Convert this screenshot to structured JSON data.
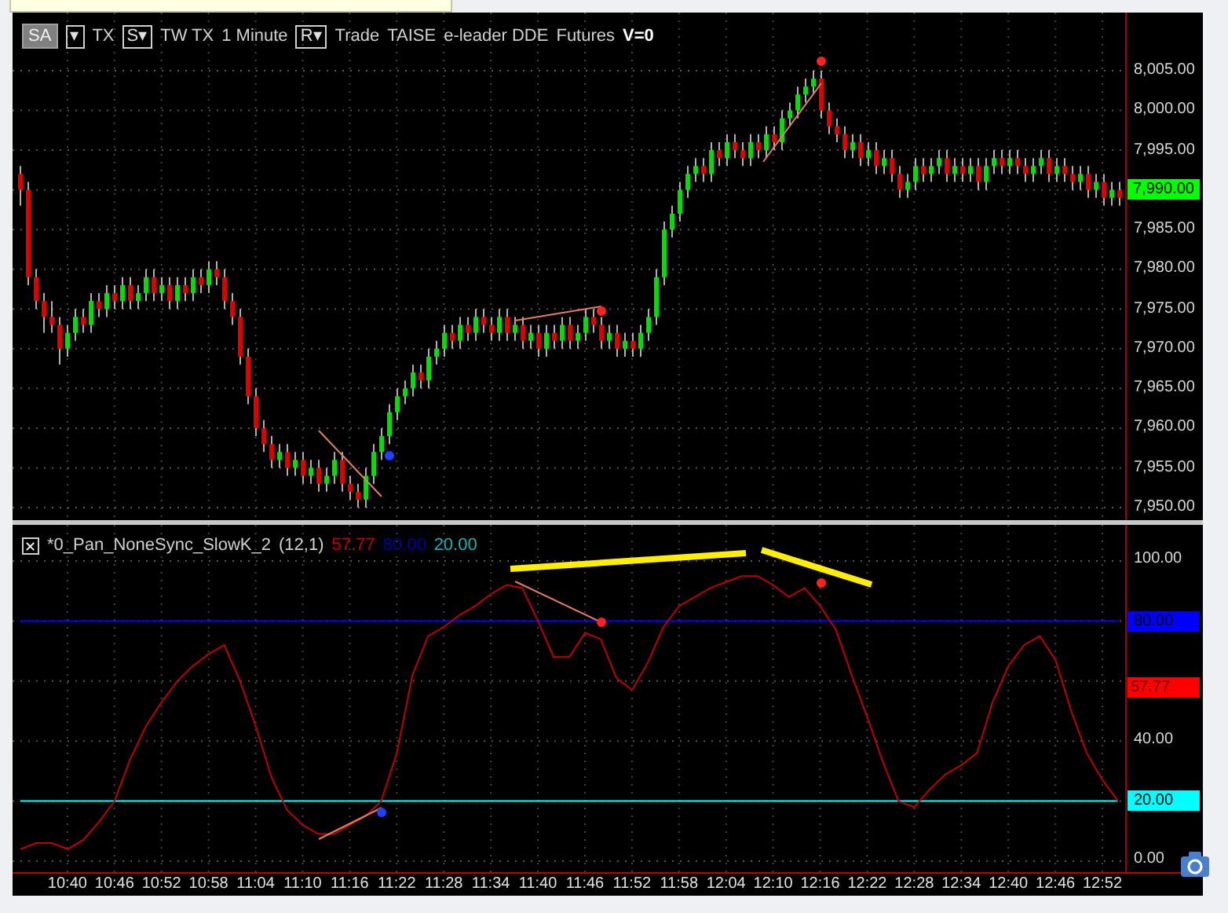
{
  "toolbar": [
    {
      "kind": "box",
      "text": "SA"
    },
    {
      "kind": "dropdown",
      "text": "▾"
    },
    {
      "kind": "label",
      "text": "TX"
    },
    {
      "kind": "dropdown",
      "text": "S▾"
    },
    {
      "kind": "label",
      "text": "TW TX"
    },
    {
      "kind": "label",
      "text": "1 Minute"
    },
    {
      "kind": "dropdown",
      "text": "R▾"
    },
    {
      "kind": "label",
      "text": "Trade"
    },
    {
      "kind": "label",
      "text": "TAISE"
    },
    {
      "kind": "label",
      "text": "e-leader DDE"
    },
    {
      "kind": "label",
      "text": "Futures"
    },
    {
      "kind": "strong",
      "text": "V=0"
    }
  ],
  "price_pane": {
    "last_price": "7,990.00",
    "chart_data": {
      "type": "candlestick",
      "grid": true,
      "ylim": [
        7948,
        8012
      ],
      "yticks": [
        {
          "value": 8005,
          "label": "8,005.00"
        },
        {
          "value": 8000,
          "label": "8,000.00"
        },
        {
          "value": 7995,
          "label": "7,995.00"
        },
        {
          "value": 7985,
          "label": "7,985.00"
        },
        {
          "value": 7980,
          "label": "7,980.00"
        },
        {
          "value": 7975,
          "label": "7,975.00"
        },
        {
          "value": 7970,
          "label": "7,970.00"
        },
        {
          "value": 7965,
          "label": "7,965.00"
        },
        {
          "value": 7960,
          "label": "7,960.00"
        },
        {
          "value": 7955,
          "label": "7,955.00"
        },
        {
          "value": 7950,
          "label": "7,950.00"
        }
      ],
      "categories": [
        null,
        null,
        null,
        null,
        null,
        null,
        null,
        null,
        null,
        null,
        null,
        null,
        null,
        null,
        null,
        null,
        null,
        null,
        null,
        null,
        null,
        null,
        null,
        null,
        null,
        null,
        null,
        null,
        null,
        null,
        null,
        null,
        null,
        null,
        null,
        null,
        null,
        null,
        null,
        null,
        null,
        null,
        null,
        null,
        null,
        null,
        null,
        null,
        null,
        null,
        null,
        null,
        null,
        null,
        null,
        null,
        null,
        null,
        null,
        null,
        null,
        null,
        null,
        null,
        null,
        null,
        null,
        null,
        null,
        null,
        null,
        null,
        null,
        null,
        null,
        null,
        null,
        null,
        null,
        null,
        null,
        null,
        null,
        null,
        null,
        null,
        null,
        null,
        null,
        null,
        null,
        null,
        null,
        null,
        null,
        null,
        null,
        null,
        null,
        null,
        null,
        null,
        null,
        null,
        null,
        null,
        null,
        null,
        null,
        null,
        null,
        null,
        null,
        null,
        null,
        null,
        null,
        null,
        null,
        null,
        null,
        null,
        null,
        null,
        null,
        null,
        null,
        null,
        null,
        null,
        null,
        null,
        null,
        null,
        null,
        null,
        null,
        null,
        null,
        null,
        null
      ],
      "ohlc": [
        [
          7992,
          7993,
          7988,
          7990
        ],
        [
          7990,
          7991,
          7978,
          7979
        ],
        [
          7979,
          7980,
          7975,
          7976
        ],
        [
          7976,
          7977,
          7972,
          7974
        ],
        [
          7974,
          7976,
          7972,
          7973
        ],
        [
          7973,
          7974,
          7968,
          7970
        ],
        [
          7970,
          7973,
          7969,
          7972
        ],
        [
          7972,
          7975,
          7971,
          7974
        ],
        [
          7974,
          7975,
          7972,
          7973
        ],
        [
          7973,
          7977,
          7972,
          7976
        ],
        [
          7976,
          7977,
          7974,
          7975
        ],
        [
          7975,
          7978,
          7974,
          7977
        ],
        [
          7977,
          7978,
          7975,
          7976
        ],
        [
          7976,
          7979,
          7975,
          7978
        ],
        [
          7978,
          7979,
          7975,
          7976
        ],
        [
          7976,
          7978,
          7975,
          7977
        ],
        [
          7977,
          7980,
          7976,
          7979
        ],
        [
          7979,
          7980,
          7976,
          7977
        ],
        [
          7977,
          7979,
          7976,
          7978
        ],
        [
          7978,
          7979,
          7975,
          7976
        ],
        [
          7976,
          7979,
          7975,
          7978
        ],
        [
          7978,
          7979,
          7976,
          7977
        ],
        [
          7977,
          7980,
          7976,
          7979
        ],
        [
          7979,
          7980,
          7977,
          7978
        ],
        [
          7978,
          7981,
          7977,
          7980
        ],
        [
          7980,
          7981,
          7978,
          7979
        ],
        [
          7979,
          7980,
          7975,
          7976
        ],
        [
          7976,
          7977,
          7973,
          7974
        ],
        [
          7974,
          7975,
          7968,
          7969
        ],
        [
          7969,
          7970,
          7963,
          7964
        ],
        [
          7964,
          7965,
          7959,
          7960
        ],
        [
          7960,
          7961,
          7957,
          7958
        ],
        [
          7958,
          7959,
          7955,
          7956
        ],
        [
          7956,
          7958,
          7955,
          7957
        ],
        [
          7957,
          7958,
          7954,
          7955
        ],
        [
          7955,
          7957,
          7954,
          7956
        ],
        [
          7956,
          7957,
          7953,
          7954
        ],
        [
          7954,
          7956,
          7953,
          7955
        ],
        [
          7955,
          7956,
          7952,
          7953
        ],
        [
          7953,
          7955,
          7952,
          7954
        ],
        [
          7954,
          7957,
          7953,
          7956
        ],
        [
          7956,
          7957,
          7952,
          7953
        ],
        [
          7953,
          7954,
          7951,
          7952
        ],
        [
          7952,
          7953,
          7950,
          7951
        ],
        [
          7951,
          7955,
          7950,
          7954
        ],
        [
          7954,
          7958,
          7953,
          7957
        ],
        [
          7957,
          7960,
          7956,
          7959
        ],
        [
          7959,
          7963,
          7958,
          7962
        ],
        [
          7962,
          7965,
          7961,
          7964
        ],
        [
          7964,
          7966,
          7963,
          7965
        ],
        [
          7965,
          7968,
          7964,
          7967
        ],
        [
          7967,
          7968,
          7965,
          7966
        ],
        [
          7966,
          7970,
          7965,
          7969
        ],
        [
          7969,
          7971,
          7968,
          7970
        ],
        [
          7970,
          7973,
          7969,
          7972
        ],
        [
          7972,
          7973,
          7970,
          7971
        ],
        [
          7971,
          7974,
          7970,
          7973
        ],
        [
          7973,
          7974,
          7971,
          7972
        ],
        [
          7972,
          7975,
          7971,
          7974
        ],
        [
          7974,
          7975,
          7972,
          7973
        ],
        [
          7973,
          7974,
          7971,
          7972
        ],
        [
          7972,
          7975,
          7971,
          7974
        ],
        [
          7974,
          7975,
          7971,
          7972
        ],
        [
          7972,
          7974,
          7971,
          7973
        ],
        [
          7973,
          7974,
          7970,
          7971
        ],
        [
          7971,
          7973,
          7970,
          7972
        ],
        [
          7972,
          7973,
          7969,
          7970
        ],
        [
          7970,
          7973,
          7969,
          7972
        ],
        [
          7972,
          7973,
          7970,
          7971
        ],
        [
          7971,
          7974,
          7970,
          7973
        ],
        [
          7973,
          7974,
          7970,
          7971
        ],
        [
          7971,
          7973,
          7970,
          7972
        ],
        [
          7972,
          7975,
          7971,
          7974
        ],
        [
          7974,
          7975,
          7972,
          7973
        ],
        [
          7973,
          7974,
          7970,
          7971
        ],
        [
          7971,
          7973,
          7970,
          7972
        ],
        [
          7972,
          7973,
          7969,
          7970
        ],
        [
          7970,
          7972,
          7969,
          7971
        ],
        [
          7971,
          7972,
          7969,
          7970
        ],
        [
          7970,
          7973,
          7969,
          7972
        ],
        [
          7972,
          7975,
          7971,
          7974
        ],
        [
          7974,
          7980,
          7973,
          7979
        ],
        [
          7979,
          7986,
          7978,
          7985
        ],
        [
          7985,
          7988,
          7984,
          7987
        ],
        [
          7987,
          7991,
          7986,
          7990
        ],
        [
          7990,
          7993,
          7989,
          7992
        ],
        [
          7992,
          7994,
          7991,
          7993
        ],
        [
          7993,
          7994,
          7991,
          7992
        ],
        [
          7992,
          7996,
          7991,
          7995
        ],
        [
          7995,
          7996,
          7993,
          7994
        ],
        [
          7994,
          7997,
          7993,
          7996
        ],
        [
          7996,
          7997,
          7994,
          7995
        ],
        [
          7995,
          7996,
          7993,
          7994
        ],
        [
          7994,
          7997,
          7993,
          7996
        ],
        [
          7996,
          7997,
          7994,
          7995
        ],
        [
          7995,
          7998,
          7994,
          7997
        ],
        [
          7997,
          7998,
          7995,
          7996
        ],
        [
          7996,
          8000,
          7995,
          7999
        ],
        [
          7999,
          8001,
          7998,
          8000
        ],
        [
          8000,
          8003,
          7999,
          8002
        ],
        [
          8002,
          8004,
          8001,
          8003
        ],
        [
          8003,
          8005,
          8002,
          8004
        ],
        [
          8004,
          8005,
          7999,
          8000
        ],
        [
          8000,
          8001,
          7997,
          7998
        ],
        [
          7998,
          7999,
          7996,
          7997
        ],
        [
          7997,
          7998,
          7994,
          7995
        ],
        [
          7995,
          7997,
          7994,
          7996
        ],
        [
          7996,
          7997,
          7993,
          7994
        ],
        [
          7994,
          7996,
          7993,
          7995
        ],
        [
          7995,
          7996,
          7992,
          7993
        ],
        [
          7993,
          7995,
          7992,
          7994
        ],
        [
          7994,
          7995,
          7991,
          7992
        ],
        [
          7992,
          7993,
          7989,
          7990
        ],
        [
          7990,
          7992,
          7989,
          7991
        ],
        [
          7991,
          7994,
          7990,
          7993
        ],
        [
          7993,
          7994,
          7991,
          7992
        ],
        [
          7992,
          7994,
          7991,
          7993
        ],
        [
          7993,
          7995,
          7992,
          7994
        ],
        [
          7994,
          7995,
          7991,
          7992
        ],
        [
          7992,
          7994,
          7991,
          7993
        ],
        [
          7993,
          7994,
          7991,
          7992
        ],
        [
          7992,
          7994,
          7991,
          7993
        ],
        [
          7993,
          7994,
          7990,
          7991
        ],
        [
          7991,
          7994,
          7990,
          7993
        ],
        [
          7993,
          7995,
          7992,
          7994
        ],
        [
          7994,
          7995,
          7992,
          7993
        ],
        [
          7993,
          7995,
          7992,
          7994
        ],
        [
          7994,
          7995,
          7992,
          7993
        ],
        [
          7993,
          7994,
          7991,
          7992
        ],
        [
          7992,
          7994,
          7991,
          7993
        ],
        [
          7993,
          7995,
          7992,
          7994
        ],
        [
          7994,
          7995,
          7991,
          7992
        ],
        [
          7992,
          7994,
          7991,
          7993
        ],
        [
          7993,
          7994,
          7991,
          7992
        ],
        [
          7992,
          7993,
          7990,
          7991
        ],
        [
          7991,
          7993,
          7990,
          7992
        ],
        [
          7992,
          7993,
          7989,
          7990
        ],
        [
          7990,
          7992,
          7989,
          7991
        ],
        [
          7991,
          7992,
          7988,
          7989
        ],
        [
          7989,
          7991,
          7988,
          7990
        ],
        [
          7990,
          7991,
          7988,
          7989
        ]
      ]
    }
  },
  "indicator": {
    "close_icon": "✕",
    "name": "*0_Pan_NoneSync_SlowK_2",
    "params": "(12,1)",
    "values": [
      {
        "text": "57.77",
        "color": "#c00000"
      },
      {
        "text": "80.00",
        "color": "#0000a0"
      },
      {
        "text": "20.00",
        "color": "#20b0b0"
      }
    ],
    "last_value_badge": {
      "text": "57.77",
      "color": "#ff0000"
    },
    "chart_data": {
      "type": "line",
      "grid": true,
      "categories": [
        null,
        null,
        null,
        null,
        null,
        null,
        null,
        null,
        null,
        null,
        null,
        null,
        null,
        null,
        null,
        null,
        null,
        null,
        null,
        null,
        null,
        null,
        null,
        null,
        null,
        null,
        null,
        null,
        null,
        null,
        null,
        null,
        null,
        null,
        null,
        null,
        null,
        null,
        null,
        null,
        null,
        null,
        null,
        null,
        null,
        null,
        null,
        null,
        null,
        null,
        null,
        null,
        null,
        null,
        null,
        null,
        null,
        null,
        null,
        null,
        null,
        null,
        null,
        null,
        null,
        null,
        null,
        null,
        null,
        null,
        null
      ],
      "series": [
        {
          "color": "#0000ff",
          "values": [
            80,
            80,
            80,
            80,
            80,
            80,
            80,
            80,
            80,
            80,
            80,
            80,
            80,
            80,
            80,
            80,
            80,
            80,
            80,
            80,
            80,
            80,
            80,
            80,
            80,
            80,
            80,
            80,
            80,
            80,
            80,
            80,
            80,
            80,
            80,
            80,
            80,
            80,
            80,
            80,
            80,
            80,
            80,
            80,
            80,
            80,
            80,
            80,
            80,
            80,
            80,
            80,
            80,
            80,
            80,
            80,
            80,
            80,
            80,
            80,
            80,
            80,
            80,
            80,
            80,
            80,
            80,
            80,
            80,
            80,
            80
          ]
        },
        {
          "color": "#00ffff",
          "values": [
            20,
            20,
            20,
            20,
            20,
            20,
            20,
            20,
            20,
            20,
            20,
            20,
            20,
            20,
            20,
            20,
            20,
            20,
            20,
            20,
            20,
            20,
            20,
            20,
            20,
            20,
            20,
            20,
            20,
            20,
            20,
            20,
            20,
            20,
            20,
            20,
            20,
            20,
            20,
            20,
            20,
            20,
            20,
            20,
            20,
            20,
            20,
            20,
            20,
            20,
            20,
            20,
            20,
            20,
            20,
            20,
            20,
            20,
            20,
            20,
            20,
            20,
            20,
            20,
            20,
            20,
            20,
            20,
            20,
            20,
            20
          ]
        },
        {
          "color": "#c00000",
          "values": [
            4,
            6,
            6,
            4,
            7,
            13,
            20,
            34,
            45,
            53,
            60,
            65,
            69,
            72,
            60,
            45,
            28,
            17,
            12,
            9,
            9,
            12,
            15,
            20,
            36,
            62,
            75,
            78,
            82,
            85,
            89,
            92,
            91,
            80,
            68,
            68,
            76,
            74,
            61,
            57,
            66,
            78,
            85,
            88,
            91,
            93,
            95,
            95,
            92,
            88,
            91,
            85,
            77,
            62,
            48,
            33,
            20,
            18,
            24,
            29,
            32,
            36,
            53,
            65,
            72,
            75,
            67,
            50,
            36,
            27,
            20
          ]
        }
      ],
      "ylim": [
        0,
        100
      ],
      "yticks": [
        {
          "value": 0,
          "label": "0.00"
        },
        {
          "value": 20,
          "label": "20.00"
        },
        {
          "value": 40,
          "label": "40.00"
        },
        {
          "value": 80,
          "label": "80.00"
        },
        {
          "value": 100,
          "label": "100.00"
        }
      ]
    }
  },
  "time_axis": [
    "10:40",
    "10:46",
    "10:52",
    "10:58",
    "11:04",
    "11:10",
    "11:16",
    "11:22",
    "11:28",
    "11:34",
    "11:40",
    "11:46",
    "11:52",
    "11:58",
    "12:04",
    "12:10",
    "12:16",
    "12:22",
    "12:28",
    "12:34",
    "12:40",
    "12:46",
    "12:52"
  ]
}
